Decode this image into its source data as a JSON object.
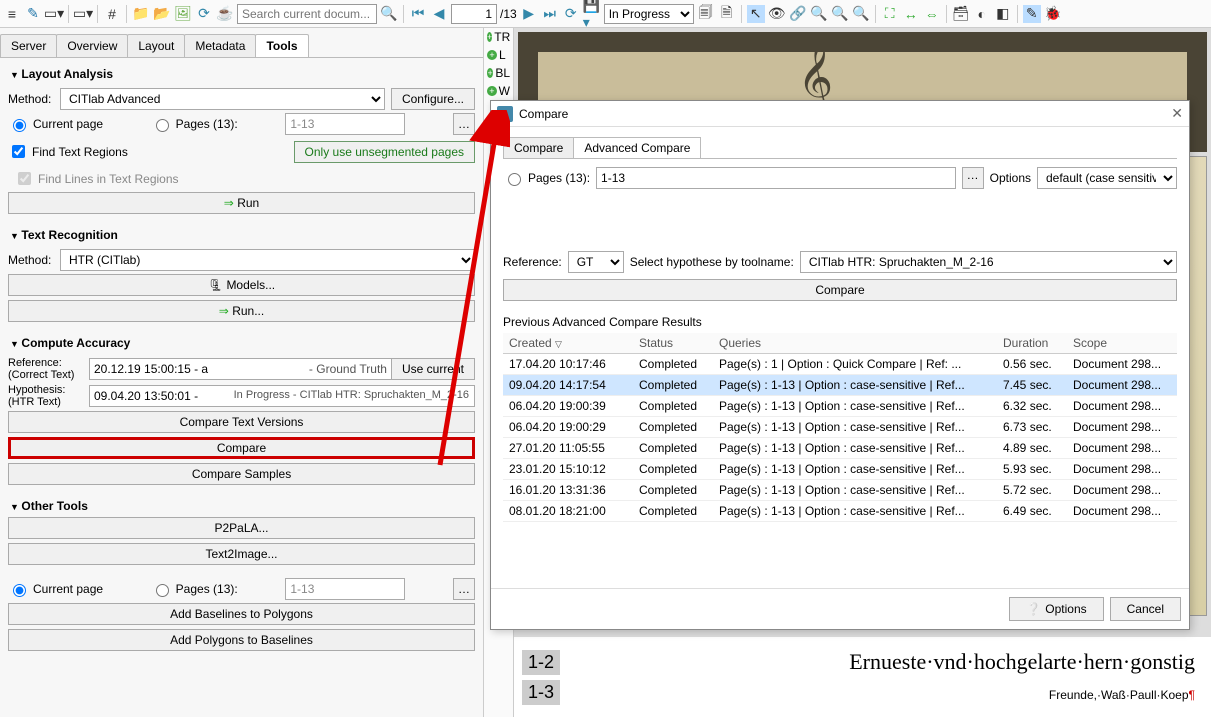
{
  "toolbar": {
    "search_placeholder": "Search current docum...",
    "page": "1",
    "total_pages": "/13",
    "status_options": [
      "In Progress"
    ],
    "status_value": "In Progress"
  },
  "tabs": {
    "server": "Server",
    "overview": "Overview",
    "layout": "Layout",
    "metadata": "Metadata",
    "tools": "Tools"
  },
  "tools": {
    "layout_analysis": {
      "title": "Layout Analysis",
      "method_label": "Method:",
      "method_value": "CITlab Advanced",
      "configure": "Configure...",
      "current_page": "Current page",
      "pages_label": "Pages (13):",
      "pages_value": "1-13",
      "find_regions": "Find Text Regions",
      "find_lines": "Find Lines in Text Regions",
      "only_unsegmented": "Only use unsegmented pages",
      "run": "Run"
    },
    "text_recognition": {
      "title": "Text Recognition",
      "method_label": "Method:",
      "method_value": "HTR (CITlab)",
      "models": "Models...",
      "run": "Run..."
    },
    "accuracy": {
      "title": "Compute Accuracy",
      "ref_label_1": "Reference:",
      "ref_label_2": "(Correct Text)",
      "ref_value": "20.12.19 15:00:15 - a",
      "gt": "- Ground Truth",
      "use_current": "Use current",
      "hyp_label_1": "Hypothesis:",
      "hyp_label_2": "(HTR Text)",
      "hyp_value": "09.04.20 13:50:01 -",
      "hyp_status": "In Progress - CITlab HTR: Spruchakten_M_2-16",
      "compare_versions": "Compare Text Versions",
      "compare": "Compare",
      "compare_samples": "Compare Samples"
    },
    "other": {
      "title": "Other Tools",
      "p2pala": "P2PaLA...",
      "text2image": "Text2Image...",
      "current_page": "Current page",
      "pages_label": "Pages (13):",
      "pages_value": "1-13",
      "add_base": "Add Baselines to Polygons",
      "add_poly": "Add Polygons to Baselines"
    }
  },
  "rstrip": {
    "tr": "TR",
    "l": "L",
    "bl": "BL",
    "w": "W"
  },
  "dialog": {
    "title": "Compare",
    "tab_compare": "Compare",
    "tab_advanced": "Advanced Compare",
    "pages_label": "Pages (13):",
    "pages_value": "1-13",
    "options_label": "Options",
    "options_value": "default (case sensitive)",
    "reference_label": "Reference:",
    "reference_value": "GT",
    "hypothese_label": "Select hypothese by toolname:",
    "hypothese_value": "CITlab HTR: Spruchakten_M_2-16",
    "compare_btn": "Compare",
    "prev_header": "Previous Advanced Compare Results",
    "cols": {
      "created": "Created",
      "status": "Status",
      "queries": "Queries",
      "duration": "Duration",
      "scope": "Scope"
    },
    "rows": [
      {
        "created": "17.04.20 10:17:46",
        "status": "Completed",
        "queries": "Page(s) : 1 | Option : Quick Compare | Ref: ...",
        "duration": "0.56 sec.",
        "scope": "Document 298..."
      },
      {
        "created": "09.04.20 14:17:54",
        "status": "Completed",
        "queries": "Page(s) : 1-13 | Option : case-sensitive | Ref...",
        "duration": "7.45 sec.",
        "scope": "Document 298...",
        "selected": true
      },
      {
        "created": "06.04.20 19:00:39",
        "status": "Completed",
        "queries": "Page(s) : 1-13 | Option : case-sensitive | Ref...",
        "duration": "6.32 sec.",
        "scope": "Document 298..."
      },
      {
        "created": "06.04.20 19:00:29",
        "status": "Completed",
        "queries": "Page(s) : 1-13 | Option : case-sensitive | Ref...",
        "duration": "6.73 sec.",
        "scope": "Document 298..."
      },
      {
        "created": "27.01.20 11:05:55",
        "status": "Completed",
        "queries": "Page(s) : 1-13 | Option : case-sensitive | Ref...",
        "duration": "4.89 sec.",
        "scope": "Document 298..."
      },
      {
        "created": "23.01.20 15:10:12",
        "status": "Completed",
        "queries": "Page(s) : 1-13 | Option : case-sensitive | Ref...",
        "duration": "5.93 sec.",
        "scope": "Document 298..."
      },
      {
        "created": "16.01.20 13:31:36",
        "status": "Completed",
        "queries": "Page(s) : 1-13 | Option : case-sensitive | Ref...",
        "duration": "5.72 sec.",
        "scope": "Document 298..."
      },
      {
        "created": "08.01.20 18:21:00",
        "status": "Completed",
        "queries": "Page(s) : 1-13 | Option : case-sensitive | Ref...",
        "duration": "6.49 sec.",
        "scope": "Document 298..."
      }
    ],
    "options_btn": "Options",
    "cancel_btn": "Cancel"
  },
  "doc": {
    "line1_num": "1-2",
    "line1_text": "Ernueste·vnd·hochgelarte·hern·gonstig",
    "line2_num": "1-3",
    "line2_text": "Freunde,·Waß·Paull·Koep"
  }
}
